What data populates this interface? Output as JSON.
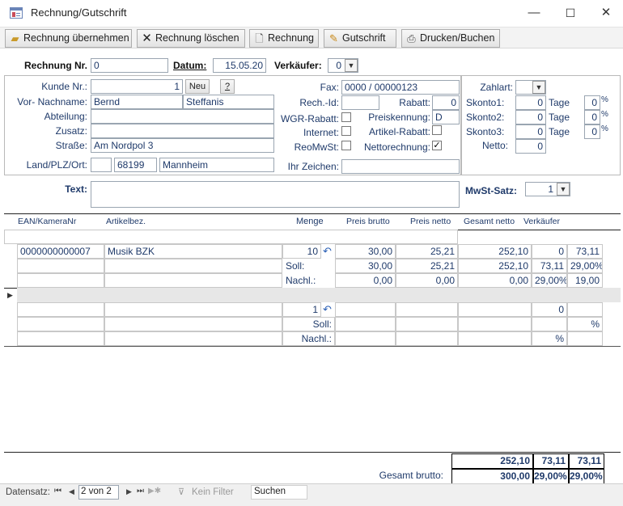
{
  "window": {
    "title": "Rechnung/Gutschrift",
    "min": "—",
    "max": "☐",
    "close": "✕"
  },
  "toolbar": {
    "take_over": "Rechnung übernehmen",
    "delete": "Rechnung löschen",
    "invoice": "Rechnung",
    "credit": "Gutschrift",
    "print": "Drucken/Buchen"
  },
  "header": {
    "rechnung_nr_label": "Rechnung Nr.",
    "rechnung_nr": "0",
    "datum_label": "Datum:",
    "datum": "15.05.20",
    "verkaeufer_label": "Verkäufer:",
    "verkaeufer": "0"
  },
  "customer": {
    "kunde_label": "Kunde Nr.:",
    "kunde_nr": "1",
    "neu_label": "Neu",
    "help_label": "?",
    "name_label": "Vor- Nachname:",
    "vorname": "Bernd",
    "nachname": "Steffanis",
    "abteilung_label": "Abteilung:",
    "abteilung": "",
    "zusatz_label": "Zusatz:",
    "zusatz": "",
    "strasse_label": "Straße:",
    "strasse": "Am Nordpol 3",
    "ort_label": "Land/PLZ/Ort:",
    "land": "",
    "plz": "68199",
    "ort": "Mannheim"
  },
  "middle": {
    "fax_label": "Fax:",
    "fax": "0000 / 00000123",
    "rechid_label": "Rech.-Id:",
    "rechid": "",
    "rabatt_label": "Rabatt:",
    "rabatt": "0",
    "wgr_label": "WGR-Rabatt:",
    "preiskennung_label": "Preiskennung:",
    "preiskennung": "D",
    "internet_label": "Internet:",
    "artikelrabatt_label": "Artikel-Rabatt:",
    "reomwst_label": "ReoMwSt:",
    "netto_label": "Nettorechnung:",
    "netto_check": "✓",
    "ihrzeichen_label": "Ihr Zeichen:",
    "ihrzeichen": ""
  },
  "payment": {
    "zahlart_label": "Zahlart:",
    "skonto1_label": "Skonto1:",
    "skonto1": "0",
    "tage1_label": "Tage",
    "tage1": "0",
    "skonto2_label": "Skonto2:",
    "skonto2": "0",
    "tage2_label": "Tage",
    "tage2": "0",
    "skonto3_label": "Skonto3:",
    "skonto3": "0",
    "tage3_label": "Tage",
    "tage3": "0",
    "netto_label": "Netto:",
    "netto": "0",
    "percent": "%"
  },
  "text": {
    "label": "Text:",
    "value": "",
    "mwst_label": "MwSt-Satz:",
    "mwst": "1"
  },
  "columns": [
    "EAN/KameraNr",
    "Artikelbez.",
    "Menge",
    "Preis brutto",
    "Preis netto",
    "Gesamt netto",
    "Verkäufer"
  ],
  "row1": {
    "ean": "0000000000007",
    "artikel": "Musik BZK",
    "menge": "10",
    "brutto": "30,00",
    "netto": "25,21",
    "gesamt": "252,10",
    "verk": "0",
    "extra": "73,11",
    "soll_label": "Soll:",
    "soll_brutto": "30,00",
    "soll_netto": "25,21",
    "soll_gesamt": "252,10",
    "soll_verk": "73,11",
    "soll_extra": "29,00%",
    "nachl_label": "Nachl.:",
    "nachl_brutto": "0,00",
    "nachl_netto": "0,00",
    "nachl_gesamt": "0,00",
    "nachl_verk": "29,00%",
    "nachl_extra": "19,00"
  },
  "row2": {
    "marker": "▶",
    "menge": "1",
    "verk": "0",
    "soll_label": "Soll:",
    "soll_extra": "%",
    "nachl_label": "Nachl.:",
    "nachl_verk": "%"
  },
  "totals": {
    "gesamt_netto": "252,10",
    "t2": "73,11",
    "t3": "73,11",
    "label": "Gesamt brutto:",
    "brutto": "300,00",
    "p1": "29,00%",
    "p2": "29,00%"
  },
  "status": {
    "label": "Datensatz:",
    "record": "2 von 2",
    "filter": "Kein Filter",
    "search": "Suchen"
  }
}
